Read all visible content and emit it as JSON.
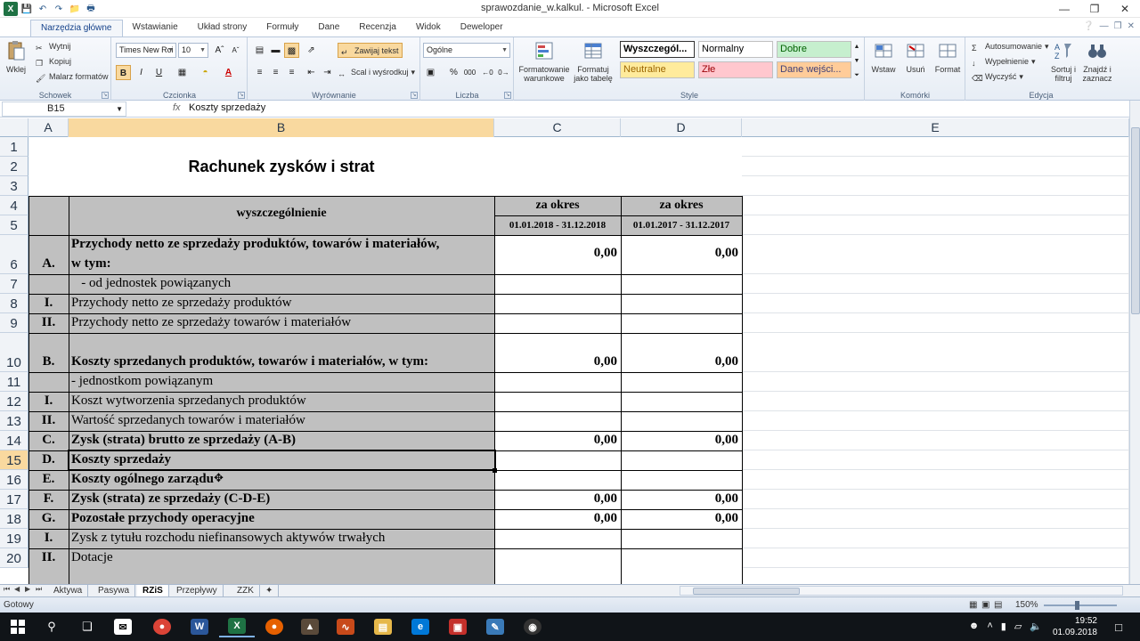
{
  "window": {
    "title": "sprawozdanie_w.kalkul. - Microsoft Excel",
    "minimize_icon": "minimize-icon",
    "restore_icon": "restore-icon",
    "close_icon": "close-icon"
  },
  "ribbon_tabs": [
    "Narzędzia główne",
    "Wstawianie",
    "Układ strony",
    "Formuły",
    "Dane",
    "Recenzja",
    "Widok",
    "Deweloper"
  ],
  "ribbon": {
    "clipboard": {
      "label": "Schowek",
      "paste": "Wklej",
      "cut": "Wytnij",
      "copy": "Kopiuj",
      "format_painter": "Malarz formatów"
    },
    "font": {
      "label": "Czcionka",
      "name": "Times New Roi",
      "size": "10",
      "bold": "B",
      "italic": "I",
      "underline": "U"
    },
    "alignment": {
      "label": "Wyrównanie",
      "wrap": "Zawijaj tekst",
      "merge": "Scal i wyśrodkuj"
    },
    "number": {
      "label": "Liczba",
      "format": "Ogólne",
      "percent": "%",
      "thousands": "000"
    },
    "styles": {
      "label": "Style",
      "conditional": "Formatowanie warunkowe",
      "as_table": "Formatuj jako tabelę",
      "cells": [
        {
          "text": "Wyszczegól...",
          "bg": "#ffffff",
          "fg": "#000000",
          "bold": true
        },
        {
          "text": "Normalny",
          "bg": "#ffffff",
          "fg": "#000000",
          "bold": false
        },
        {
          "text": "Dobre",
          "bg": "#c6efce",
          "fg": "#006100",
          "bold": false
        },
        {
          "text": "Neutralne",
          "bg": "#ffeb9c",
          "fg": "#9c6500",
          "bold": false
        },
        {
          "text": "Złe",
          "bg": "#ffc7ce",
          "fg": "#9c0006",
          "bold": false
        },
        {
          "text": "Dane wejści...",
          "bg": "#ffcc99",
          "fg": "#3f3f76",
          "bold": false
        }
      ]
    },
    "cells_group": {
      "label": "Komórki",
      "insert": "Wstaw",
      "delete": "Usuń",
      "format": "Format"
    },
    "editing": {
      "label": "Edycja",
      "autosum": "Autosumowanie",
      "fill": "Wypełnienie",
      "clear": "Wyczyść",
      "sort": "Sortuj i filtruj",
      "find": "Znajdź i zaznacz"
    }
  },
  "formula_bar": {
    "name_box": "B15",
    "fx": "fx",
    "value": "Koszty sprzedaży"
  },
  "columns": [
    "A",
    "B",
    "C",
    "D",
    "E"
  ],
  "rows": [
    "1",
    "2",
    "3",
    "4",
    "5",
    "6",
    "7",
    "8",
    "9",
    "10",
    "11",
    "12",
    "13",
    "14",
    "15",
    "16",
    "17",
    "18",
    "19",
    "20"
  ],
  "sheet": {
    "title": "Rachunek zysków i strat",
    "header_desc": "wyszczególnienie",
    "period_label": "za okres",
    "period1": "01.01.2018 - 31.12.2018",
    "period2": "01.01.2017 - 31.12.2017",
    "items": [
      {
        "row": "6",
        "code": "A.",
        "desc1": "Przychody netto ze sprzedaży produktów, towarów i materiałów,",
        "desc2": "w tym:",
        "c": "0,00",
        "d": "0,00",
        "bold": true
      },
      {
        "row": "7",
        "code": "",
        "desc1": "   - od jednostek powiązanych",
        "c": "",
        "d": "",
        "bold": false
      },
      {
        "row": "8",
        "code": "I.",
        "desc1": "Przychody netto ze sprzedaży produktów",
        "c": "",
        "d": "",
        "bold": false
      },
      {
        "row": "9",
        "code": "II.",
        "desc1": "Przychody netto ze sprzedaży towarów i materiałów",
        "c": "",
        "d": "",
        "bold": false
      },
      {
        "row": "10",
        "code": "B.",
        "desc1": "Koszty sprzedanych produktów, towarów i materiałów, w tym:",
        "c": "0,00",
        "d": "0,00",
        "bold": true
      },
      {
        "row": "11",
        "code": "",
        "desc1": "- jednostkom powiązanym",
        "c": "",
        "d": "",
        "bold": false
      },
      {
        "row": "12",
        "code": "I.",
        "desc1": "Koszt wytworzenia sprzedanych produktów",
        "c": "",
        "d": "",
        "bold": false
      },
      {
        "row": "13",
        "code": "II.",
        "desc1": "Wartość sprzedanych towarów i materiałów",
        "c": "",
        "d": "",
        "bold": false
      },
      {
        "row": "14",
        "code": "C.",
        "desc1": "Zysk (strata) brutto ze sprzedaży (A-B)",
        "c": "0,00",
        "d": "0,00",
        "bold": true
      },
      {
        "row": "15",
        "code": "D.",
        "desc1": "Koszty sprzedaży",
        "c": "",
        "d": "",
        "bold": true
      },
      {
        "row": "16",
        "code": "E.",
        "desc1": "Koszty ogólnego zarządu",
        "c": "",
        "d": "",
        "bold": true
      },
      {
        "row": "17",
        "code": "F.",
        "desc1": "Zysk (strata) ze sprzedaży (C-D-E)",
        "c": "0,00",
        "d": "0,00",
        "bold": true
      },
      {
        "row": "18",
        "code": "G.",
        "desc1": "Pozostałe przychody operacyjne",
        "c": "0,00",
        "d": "0,00",
        "bold": true
      },
      {
        "row": "19",
        "code": "I.",
        "desc1": "Zysk z tytułu rozchodu niefinansowych aktywów trwałych",
        "c": "",
        "d": "",
        "bold": false
      },
      {
        "row": "20",
        "code": "II.",
        "desc1": "Dotacje",
        "c": "",
        "d": "",
        "bold": false
      }
    ]
  },
  "sheet_tabs": [
    {
      "name": "Aktywa",
      "active": false
    },
    {
      "name": "Pasywa",
      "active": false
    },
    {
      "name": "RZiS",
      "active": true
    },
    {
      "name": "Przepływy",
      "active": false
    },
    {
      "name": "ZZK",
      "active": false
    }
  ],
  "status": {
    "ready": "Gotowy",
    "zoom": "150%"
  },
  "taskbar": {
    "time": "19:52",
    "date": "01.09.2018"
  }
}
